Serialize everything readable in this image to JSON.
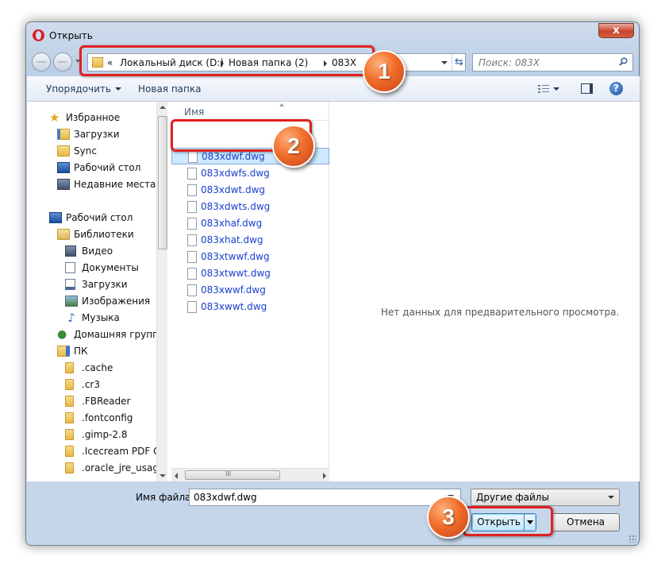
{
  "window": {
    "title": "Открыть",
    "close_label": "x"
  },
  "address": {
    "breadcrumbs": [
      {
        "label": "«"
      },
      {
        "label": "Локальный диск (D:)"
      },
      {
        "label": "Новая папка (2)"
      },
      {
        "label": "083X"
      }
    ],
    "refresh_icon": "refresh-icon"
  },
  "search": {
    "placeholder": "Поиск: 083X"
  },
  "toolbar": {
    "organize_label": "Упорядочить",
    "new_folder_label": "Новая папка"
  },
  "nav": {
    "items": [
      {
        "label": "Избранное",
        "icon": "star-icon"
      },
      {
        "label": "Загрузки",
        "icon": "downloads-folder-icon"
      },
      {
        "label": "Sync",
        "icon": "folder-icon"
      },
      {
        "label": "Рабочий стол",
        "icon": "desktop-icon"
      },
      {
        "label": "Недавние места",
        "icon": "recent-places-icon"
      },
      {
        "label": "Рабочий стол",
        "icon": "desktop-icon"
      },
      {
        "label": "Библиотеки",
        "icon": "libraries-icon"
      },
      {
        "label": "Видео",
        "icon": "video-icon"
      },
      {
        "label": "Документы",
        "icon": "documents-icon"
      },
      {
        "label": "Загрузки",
        "icon": "downloads-icon"
      },
      {
        "label": "Изображения",
        "icon": "pictures-icon"
      },
      {
        "label": "Музыка",
        "icon": "music-icon"
      },
      {
        "label": "Домашняя группа",
        "icon": "homegroup-icon"
      },
      {
        "label": "ПК",
        "icon": "computer-icon"
      },
      {
        "label": ".cache",
        "icon": "folder-icon"
      },
      {
        "label": ".cr3",
        "icon": "folder-icon"
      },
      {
        "label": ".FBReader",
        "icon": "folder-icon"
      },
      {
        "label": ".fontconfig",
        "icon": "folder-icon"
      },
      {
        "label": ".gimp-2.8",
        "icon": "folder-icon"
      },
      {
        "label": ".Icecream PDF Co",
        "icon": "folder-icon"
      },
      {
        "label": ".oracle_jre_usage",
        "icon": "folder-icon"
      }
    ]
  },
  "files": {
    "column_header": "Имя",
    "items": [
      {
        "name": "083xdwf.dwg",
        "selected": true
      },
      {
        "name": "083xdwfs.dwg"
      },
      {
        "name": "083xdwt.dwg"
      },
      {
        "name": "083xdwts.dwg"
      },
      {
        "name": "083xhaf.dwg"
      },
      {
        "name": "083xhat.dwg"
      },
      {
        "name": "083xtwwf.dwg"
      },
      {
        "name": "083xtwwt.dwg"
      },
      {
        "name": "083xwwf.dwg"
      },
      {
        "name": "083xwwt.dwg"
      }
    ],
    "hscroll_glyph": "III"
  },
  "preview": {
    "message": "Нет данных для предварительного просмотра."
  },
  "footer": {
    "filename_label": "Имя файла:",
    "filename_value": "083xdwf.dwg",
    "filetype_value": "Другие файлы",
    "open_label": "Открыть",
    "cancel_label": "Отмена"
  },
  "callouts": {
    "one": "1",
    "two": "2",
    "three": "3"
  },
  "colors": {
    "callout_border": "#e0201f",
    "badge": "#f06d2a",
    "link_text": "#1a3fcc",
    "selection": "#cde8ff"
  }
}
